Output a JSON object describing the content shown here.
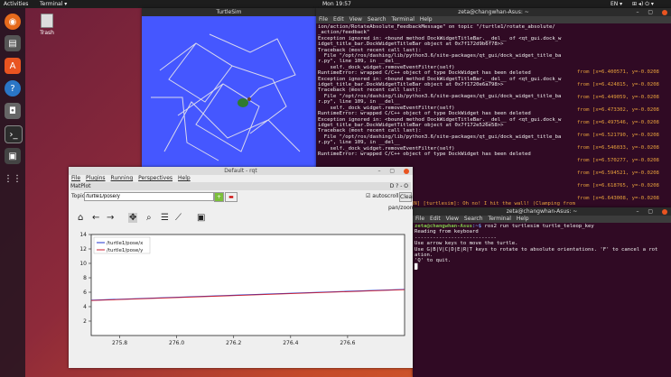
{
  "topbar": {
    "activities": "Activities",
    "app": "Terminal ▾",
    "clock": "Mon 19:57",
    "lang": "EN ▾"
  },
  "desktop": {
    "trash_label": "Trash"
  },
  "turtlesim": {
    "title": "TurtleSim",
    "bg": "#4557ff"
  },
  "terminal1": {
    "title": "zeta@changwhan-Asus: ~",
    "menu": [
      "File",
      "Edit",
      "View",
      "Search",
      "Terminal",
      "Help"
    ],
    "lines": [
      "ion/action/RotateAbsolute_FeedbackMessage\" on topic \"/turtle1/rotate_absolute/",
      "_action/feedback\"",
      "Exception ignored in: <bound method DockWidgetTitleBar.__del__ of <qt_gui.dock_w",
      "idget_title_bar.DockWidgetTitleBar object at 0x7f172d9b6f78>>",
      "Traceback (most recent call last):",
      "  File \"/opt/ros/dashing/lib/python3.6/site-packages/qt_gui/dock_widget_title_ba",
      "r.py\", line 109, in __del__",
      "    self._dock_widget.removeEventFilter(self)",
      "RuntimeError: wrapped C/C++ object of type DockWidget has been deleted",
      "Exception ignored in: <bound method DockWidgetTitleBar.__del__ of <qt_gui.dock_w",
      "idget_title_bar.DockWidgetTitleBar object at 0x7f1720e6a798>>",
      "Traceback (most recent call last):",
      "  File \"/opt/ros/dashing/lib/python3.6/site-packages/qt_gui/dock_widget_title_ba",
      "r.py\", line 109, in __del__",
      "    self._dock_widget.removeEventFilter(self)",
      "RuntimeError: wrapped C/C++ object of type DockWidget has been deleted",
      "Exception ignored in: <bound method DockWidgetTitleBar.__del__ of <qt_gui.dock_w",
      "idget_title_bar.DockWidgetTitleBar object at 0x7f172e526e58>>",
      "Traceback (most recent call last):",
      "  File \"/opt/ros/dashing/lib/python3.6/site-packages/qt_gui/dock_widget_title_ba",
      "r.py\", line 109, in __del__",
      "    self._dock_widget.removeEventFilter(self)",
      "RuntimeError: wrapped C/C++ object of type DockWidget has been deleted"
    ],
    "warn_line": "RN] [turtlesim]: Oh no! I hit the wall! (Clamping from",
    "right_column": [
      "from [x=6.400571, y=-0.0208",
      "from [x=6.424815, y=-0.0208",
      "from [x=6.449059, y=-0.0208",
      "from [x=6.473302, y=-0.0208",
      "from [x=6.497546, y=-0.0208",
      "from [x=6.521790, y=-0.0208",
      "from [x=6.546033, y=-0.0208",
      "from [x=6.570277, y=-0.0208",
      "from [x=6.594521, y=-0.0208",
      "from [x=6.618765, y=-0.0208",
      "from [x=6.643008, y=-0.0208"
    ]
  },
  "terminal2": {
    "title": "zeta@changwhan-Asus: ~",
    "menu": [
      "File",
      "Edit",
      "View",
      "Search",
      "Terminal",
      "Help"
    ],
    "prompt_user": "zeta@changwhan-Asus",
    "prompt_path": ":~$",
    "command": " ros2 run turtlesim turtle_teleop_key",
    "lines": [
      "Reading from keyboard",
      "---------------------------",
      "Use arrow keys to move the turtle.",
      "Use G|B|V|C|D|E|R|T keys to rotate to absolute orientations. 'F' to cancel a rot",
      "ation.",
      "'Q' to quit."
    ]
  },
  "rqt": {
    "title": "Default - rqt",
    "menu": [
      "File",
      "Plugins",
      "Running",
      "Perspectives",
      "Help"
    ],
    "plot_title": "MatPlot",
    "topic_label": "Topic",
    "topic_value": "/turtle1/pose/y",
    "autoscroll_label": "autoscroll",
    "clear_label": "Clear",
    "mode": "pan/zoom",
    "toolbar_icons": [
      "home-icon",
      "back-icon",
      "forward-icon",
      "pan-icon",
      "zoom-icon",
      "configure-icon",
      "lines-icon",
      "save-icon"
    ]
  },
  "chart_data": {
    "type": "line",
    "xlim": [
      275.7,
      276.8
    ],
    "ylim": [
      0,
      14
    ],
    "x_ticks": [
      275.8,
      276.0,
      276.2,
      276.4,
      276.6
    ],
    "y_ticks": [
      2,
      4,
      6,
      8,
      10,
      12,
      14
    ],
    "legend_position": "top-left",
    "series": [
      {
        "name": "/turtle1/pose/x",
        "color": "#2233cc",
        "x": [
          275.7,
          276.8
        ],
        "y": [
          4.9,
          6.4
        ]
      },
      {
        "name": "/turtle1/pose/y",
        "color": "#cc2233",
        "x": [
          275.7,
          276.8
        ],
        "y": [
          4.85,
          6.35
        ]
      }
    ]
  }
}
